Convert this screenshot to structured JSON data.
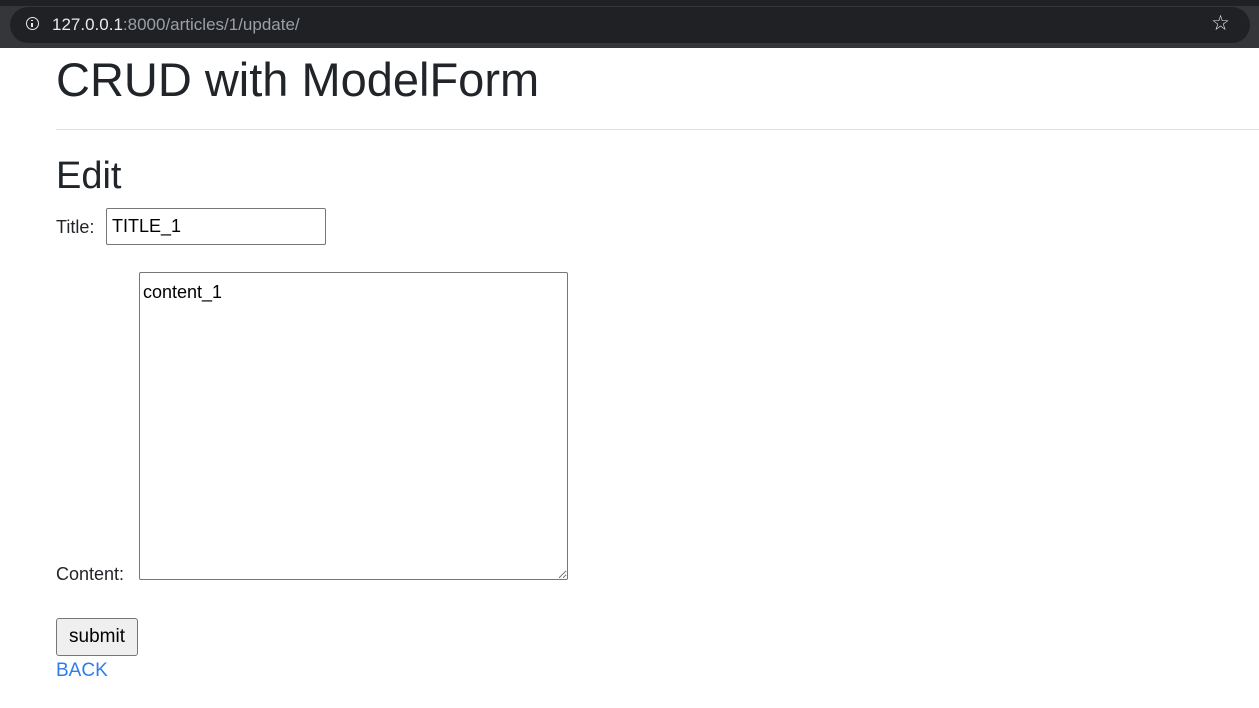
{
  "browser": {
    "url_host": "127.0.0.1",
    "url_rest": ":8000/articles/1/update/",
    "info_icon": "info-icon",
    "bookmark_icon": "star-icon",
    "bookmark_glyph": "☆"
  },
  "site": {
    "title": "CRUD with ModelForm"
  },
  "page": {
    "heading": "Edit"
  },
  "form": {
    "title_label": "Title:",
    "title_value": "TITLE_1",
    "content_label": "Content:",
    "content_value": "content_1",
    "submit_label": "submit"
  },
  "links": {
    "back_label": "BACK"
  },
  "colors": {
    "link": "#2f7ded",
    "browser_bar": "#35363a"
  }
}
